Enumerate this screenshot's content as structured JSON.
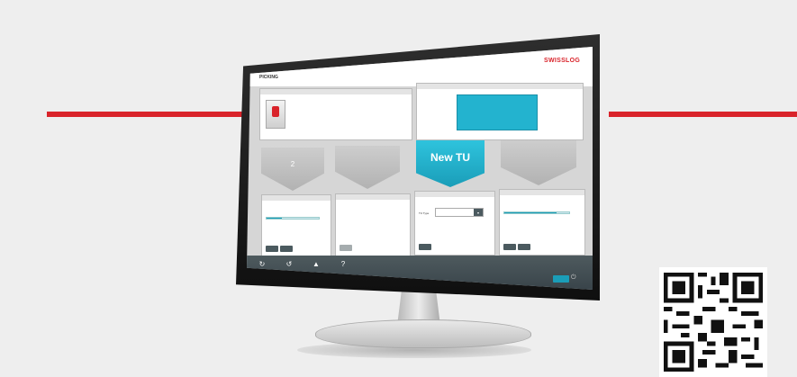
{
  "colors": {
    "brand_red": "#d9232a",
    "accent_cyan": "#1a9db8",
    "footer": "#4e5a5e"
  },
  "app": {
    "title": "PICKING",
    "header_line1": "",
    "header_line2": "",
    "brand": "SWISSLOG"
  },
  "tu_panel": {
    "head": "",
    "box_label": "",
    "dimensions": ""
  },
  "info_panel": {
    "head": "",
    "rows": [
      {
        "label": "",
        "value": ""
      },
      {
        "label": "",
        "value": ""
      },
      {
        "label": "",
        "value": ""
      },
      {
        "label": "",
        "value": ""
      },
      {
        "label": "",
        "value": ""
      }
    ]
  },
  "slots": {
    "slot1_label": "2",
    "new_tu_label": "New TU"
  },
  "order_panels": [
    {
      "head": "",
      "order_to": "",
      "count": "",
      "btn1": "",
      "btn2": ""
    },
    {
      "head": "",
      "btn1": ""
    },
    {
      "head": "",
      "tu_type_label": "TU Type",
      "select_value": "",
      "btn1": ""
    },
    {
      "head": "",
      "order_to": "",
      "count": "",
      "btn1": "",
      "btn2": ""
    }
  ],
  "footer": {
    "buttons": [
      {
        "icon": "refresh-icon",
        "label": ""
      },
      {
        "icon": "rotate-icon",
        "label": ""
      },
      {
        "icon": "warning-icon",
        "label": ""
      },
      {
        "icon": "help-icon",
        "label": ""
      }
    ]
  },
  "progress": {
    "order1_fraction": 0.3,
    "order4_fraction": 0.8
  }
}
